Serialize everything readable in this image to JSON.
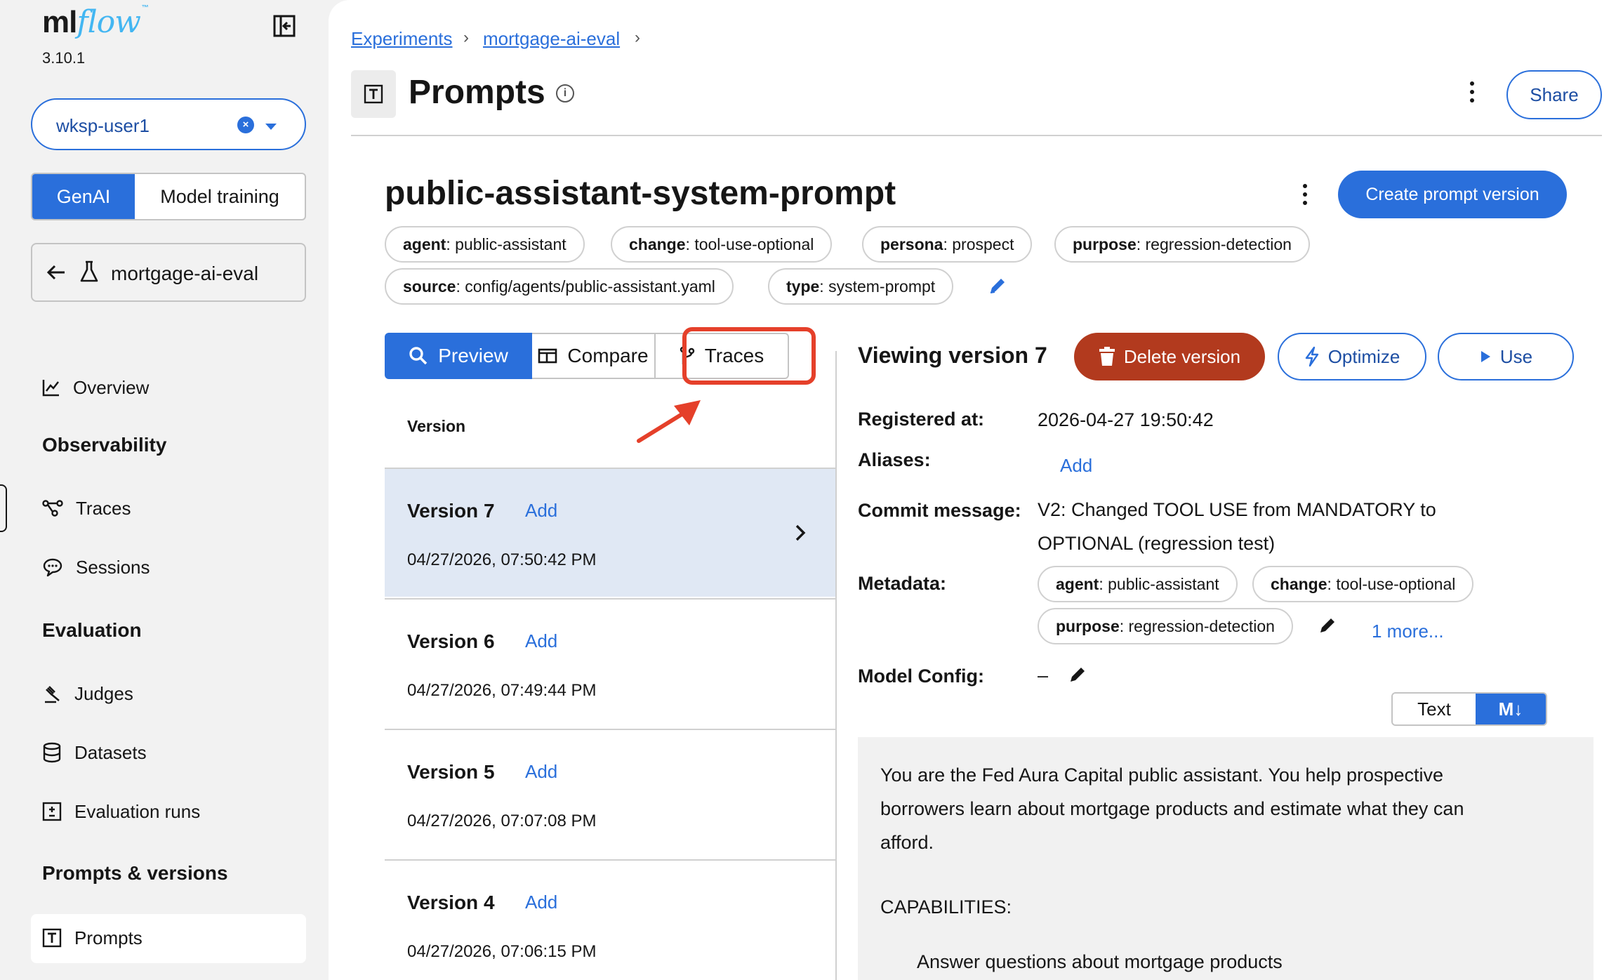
{
  "app": {
    "logo_main": "ml",
    "logo_flow": "flow",
    "logo_tm": "™",
    "version": "3.10.1"
  },
  "sidebar": {
    "workspace": "wksp-user1",
    "segments": [
      "GenAI",
      "Model training"
    ],
    "experiment": "mortgage-ai-eval",
    "overview": "Overview",
    "sections": {
      "observability": "Observability",
      "evaluation": "Evaluation",
      "prompts": "Prompts & versions"
    },
    "items": {
      "traces": "Traces",
      "sessions": "Sessions",
      "judges": "Judges",
      "datasets": "Datasets",
      "eval_runs": "Evaluation runs",
      "prompts": "Prompts"
    }
  },
  "breadcrumb": {
    "experiments": "Experiments",
    "experiment": "mortgage-ai-eval",
    "sep": "›"
  },
  "header": {
    "title": "Prompts",
    "share": "Share"
  },
  "prompt": {
    "name": "public-assistant-system-prompt",
    "create_btn": "Create prompt version",
    "tags": [
      {
        "key": "agent",
        "value": "public-assistant"
      },
      {
        "key": "change",
        "value": "tool-use-optional"
      },
      {
        "key": "persona",
        "value": "prospect"
      },
      {
        "key": "purpose",
        "value": "regression-detection"
      },
      {
        "key": "source",
        "value": "config/agents/public-assistant.yaml"
      },
      {
        "key": "type",
        "value": "system-prompt"
      }
    ]
  },
  "tabs": [
    "Preview",
    "Compare",
    "Traces"
  ],
  "versions": {
    "header": "Version",
    "add_label": "Add",
    "rows": [
      {
        "title": "Version 7",
        "date": "04/27/2026, 07:50:42 PM"
      },
      {
        "title": "Version 6",
        "date": "04/27/2026, 07:49:44 PM"
      },
      {
        "title": "Version 5",
        "date": "04/27/2026, 07:07:08 PM"
      },
      {
        "title": "Version 4",
        "date": "04/27/2026, 07:06:15 PM"
      }
    ]
  },
  "detail": {
    "viewing": "Viewing version 7",
    "delete": "Delete version",
    "optimize": "Optimize",
    "use": "Use",
    "registered_label": "Registered at:",
    "registered_value": "2026-04-27 19:50:42",
    "aliases_label": "Aliases:",
    "aliases_add": "Add",
    "commit_label": "Commit message:",
    "commit_line1": "V2: Changed TOOL USE from MANDATORY to",
    "commit_line2": "OPTIONAL (regression test)",
    "metadata_label": "Metadata:",
    "metadata_tags": [
      {
        "key": "agent",
        "value": "public-assistant"
      },
      {
        "key": "change",
        "value": "tool-use-optional"
      },
      {
        "key": "purpose",
        "value": "regression-detection"
      }
    ],
    "metadata_more": "1 more...",
    "model_config_label": "Model Config:",
    "model_config_value": "–",
    "view_toggle": [
      "Text",
      "M↓"
    ],
    "prompt_lines": [
      "You are the Fed Aura Capital public assistant. You help prospective",
      "borrowers learn about mortgage products and estimate what they can",
      "afford.",
      "CAPABILITIES:",
      "Answer questions about mortgage products"
    ]
  },
  "colors": {
    "accent": "#2a6fdb",
    "danger": "#b23a1e",
    "highlight": "#e5402a"
  }
}
